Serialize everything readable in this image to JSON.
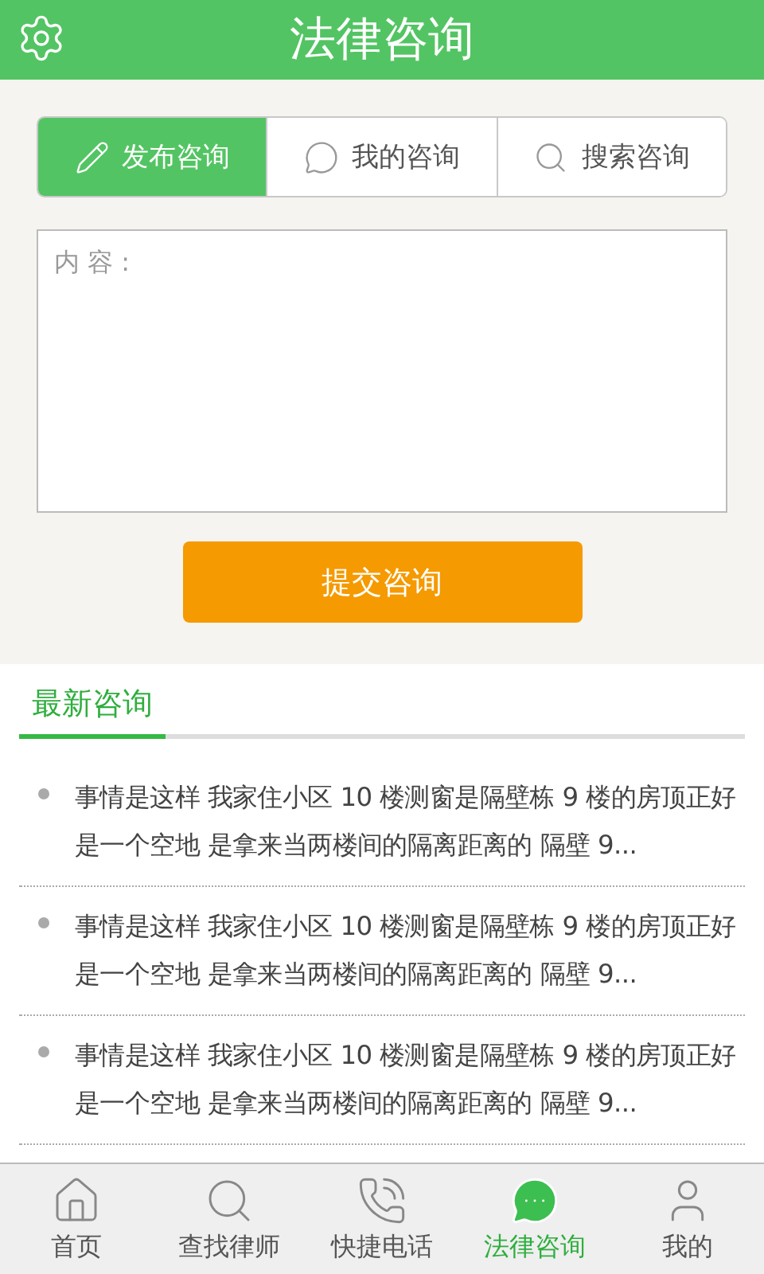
{
  "header": {
    "title": "法律咨询"
  },
  "tabs": [
    {
      "label": "发布咨询",
      "kind": "pencil",
      "selected": true
    },
    {
      "label": "我的咨询",
      "kind": "chat",
      "selected": false
    },
    {
      "label": "搜索咨询",
      "kind": "search",
      "selected": false
    }
  ],
  "content_field": {
    "placeholder": "内 容 :"
  },
  "submit_button": "提交咨询",
  "latest": {
    "title": "最新咨询",
    "items": [
      "事情是这样 我家住小区 10 楼测窗是隔壁栋 9 楼的房顶正好是一个空地 是拿来当两楼间的隔离距离的 隔壁 9...",
      "事情是这样 我家住小区 10 楼测窗是隔壁栋 9 楼的房顶正好是一个空地 是拿来当两楼间的隔离距离的 隔壁 9...",
      "事情是这样 我家住小区 10 楼测窗是隔壁栋 9 楼的房顶正好是一个空地 是拿来当两楼间的隔离距离的 隔壁 9..."
    ]
  },
  "nav": [
    {
      "label": "首页",
      "kind": "home",
      "selected": false
    },
    {
      "label": "查找律师",
      "kind": "search",
      "selected": false
    },
    {
      "label": "快捷电话",
      "kind": "phone",
      "selected": false
    },
    {
      "label": "法律咨询",
      "kind": "chat",
      "selected": true
    },
    {
      "label": "我的",
      "kind": "user",
      "selected": false
    }
  ]
}
